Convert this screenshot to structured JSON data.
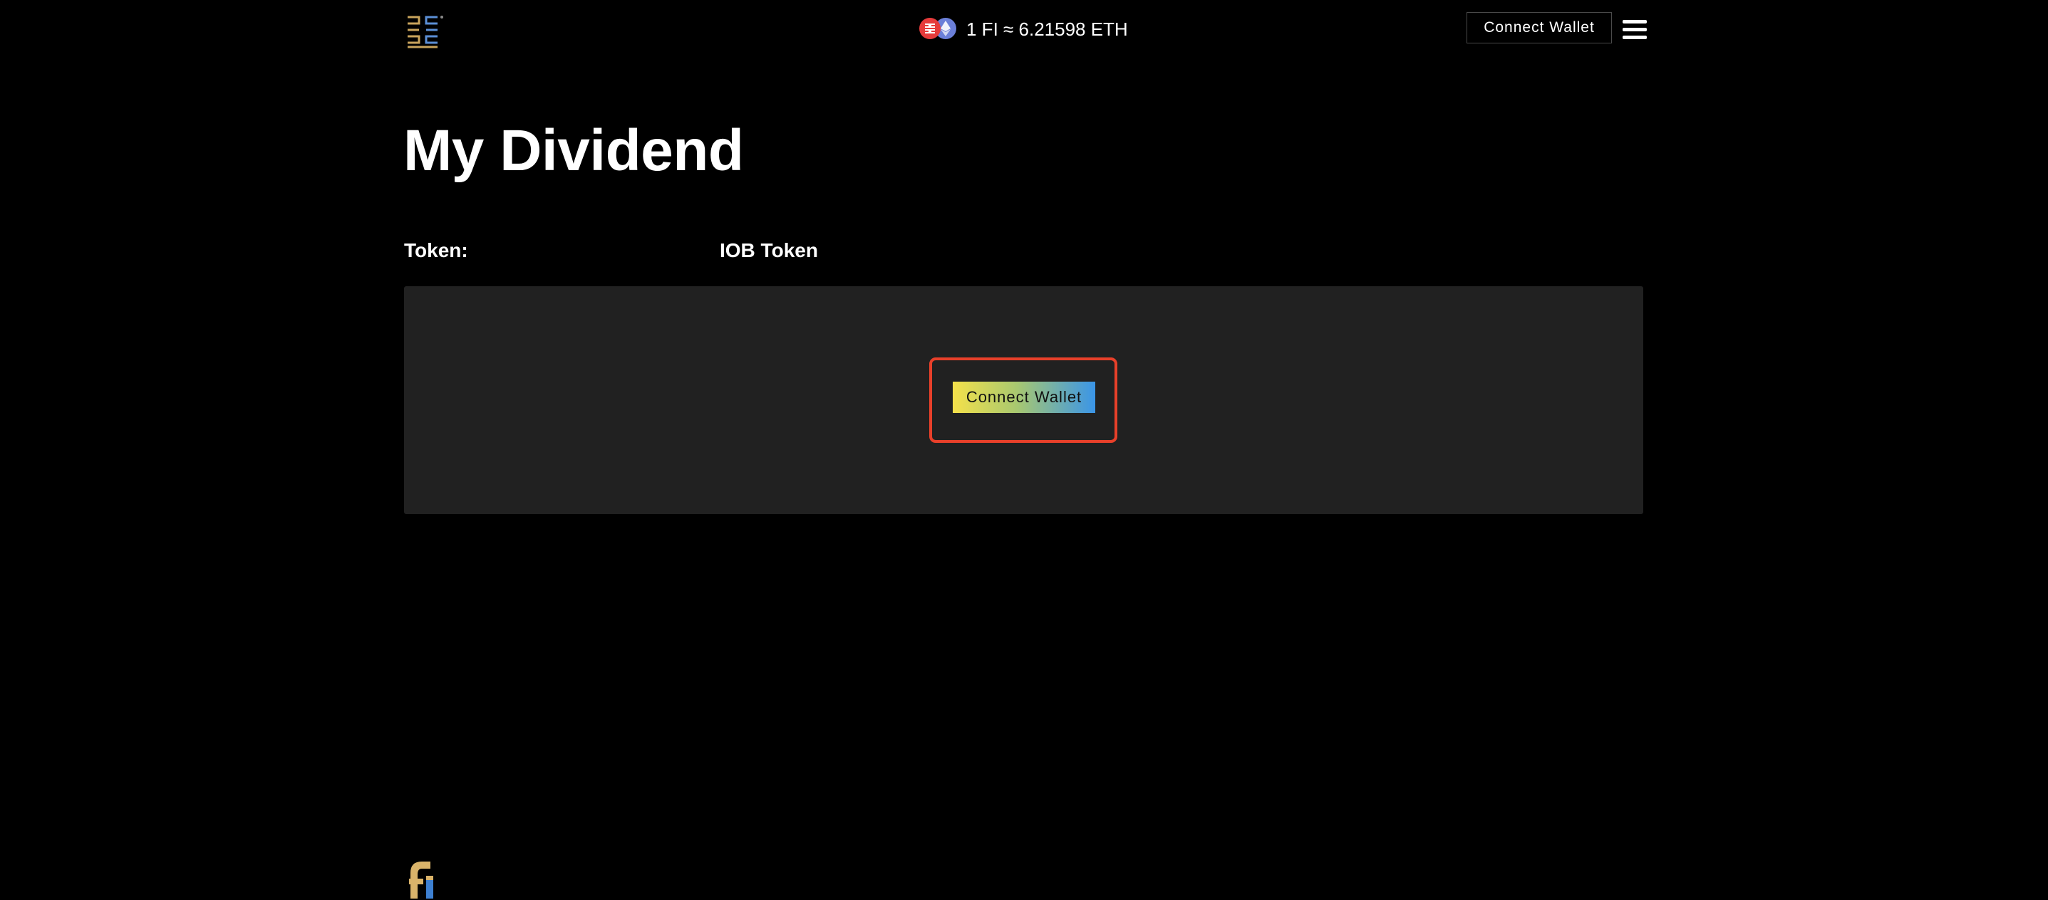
{
  "header": {
    "logo_icon": "brand-logo-icon",
    "price": {
      "base_coin_icon": "fi-token-icon",
      "quote_coin_icon": "eth-icon",
      "text": "1 FI ≈ 6.21598 ETH"
    },
    "connect_wallet_label": "Connect Wallet",
    "menu_icon": "hamburger-menu-icon"
  },
  "main": {
    "title": "My Dividend",
    "token_label": "Token:",
    "token_value": "IOB Token",
    "panel": {
      "connect_wallet_label": "Connect Wallet"
    }
  },
  "footer": {
    "logo_icon": "fi-footer-logo-icon"
  },
  "colors": {
    "background": "#000000",
    "panel": "#212121",
    "highlight_border": "#e8402a",
    "button_gradient_start": "#f5e14a",
    "button_gradient_end": "#3a95e8",
    "fi_coin": "#e63b3b",
    "eth_coin": "#6b7fd8"
  }
}
